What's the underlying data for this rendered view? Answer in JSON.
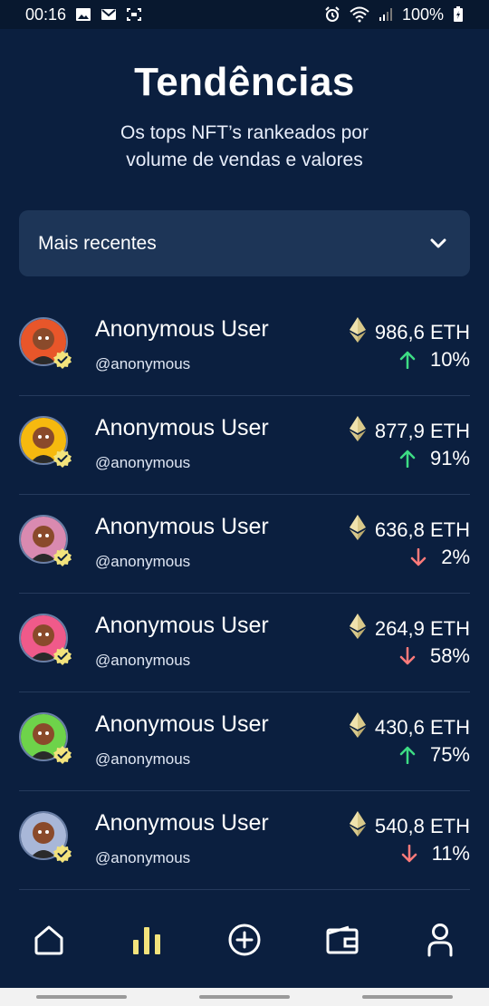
{
  "status_bar": {
    "time": "00:16",
    "battery": "100%",
    "icons": [
      "image-icon",
      "mail-icon",
      "screenshot-icon",
      "alarm-icon",
      "wifi-icon",
      "signal-icon",
      "battery-icon"
    ]
  },
  "header": {
    "title": "Tendências",
    "subtitle": "Os tops NFT’s rankeados por\nvolume de vendas e valores"
  },
  "filter": {
    "label": "Mais recentes",
    "icon": "chevron-down-icon"
  },
  "colors": {
    "background": "#0b1f3f",
    "up": "#3ddc84",
    "down": "#ff7a7a",
    "accent": "#f3e37c"
  },
  "trending": [
    {
      "name": "Anonymous User",
      "handle": "@anonymous",
      "amount": "986,6 ETH",
      "change": "10%",
      "direction": "up",
      "avatar_color": "#e8562a"
    },
    {
      "name": "Anonymous User",
      "handle": "@anonymous",
      "amount": "877,9 ETH",
      "change": "91%",
      "direction": "up",
      "avatar_color": "#f6b90f"
    },
    {
      "name": "Anonymous User",
      "handle": "@anonymous",
      "amount": "636,8 ETH",
      "change": "2%",
      "direction": "down",
      "avatar_color": "#d98ab0"
    },
    {
      "name": "Anonymous User",
      "handle": "@anonymous",
      "amount": "264,9 ETH",
      "change": "58%",
      "direction": "down",
      "avatar_color": "#f05a8a"
    },
    {
      "name": "Anonymous User",
      "handle": "@anonymous",
      "amount": "430,6 ETH",
      "change": "75%",
      "direction": "up",
      "avatar_color": "#6ed34a"
    },
    {
      "name": "Anonymous User",
      "handle": "@anonymous",
      "amount": "540,8 ETH",
      "change": "11%",
      "direction": "down",
      "avatar_color": "#a8b7d8"
    }
  ],
  "bottom_nav": [
    {
      "icon": "home-icon",
      "active": false
    },
    {
      "icon": "bar-chart-icon",
      "active": true
    },
    {
      "icon": "add-circle-icon",
      "active": false
    },
    {
      "icon": "wallet-icon",
      "active": false
    },
    {
      "icon": "profile-icon",
      "active": false
    }
  ]
}
